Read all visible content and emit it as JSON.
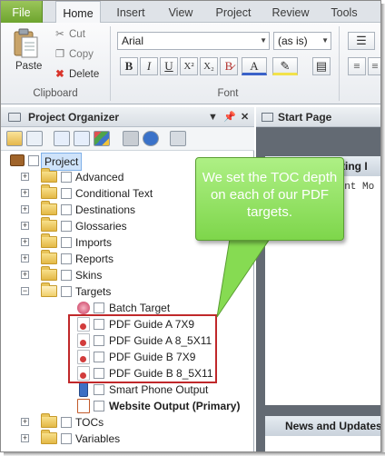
{
  "ribbon": {
    "tabs": [
      "File",
      "Home",
      "Insert",
      "View",
      "Project",
      "Review",
      "Tools"
    ],
    "clipboard": {
      "paste": "Paste",
      "cut": "Cut",
      "copy": "Copy",
      "delete": "Delete",
      "label": "Clipboard"
    },
    "font": {
      "family": "Arial",
      "size": "(as is)",
      "label": "Font"
    },
    "format_buttons": [
      "B",
      "I",
      "U",
      "X²",
      "X₂"
    ]
  },
  "project_organizer": {
    "title": "Project Organizer",
    "root": "Project",
    "folders_top": [
      "Advanced",
      "Conditional Text",
      "Destinations",
      "Glossaries",
      "Imports",
      "Reports",
      "Skins",
      "Targets"
    ],
    "targets": [
      "Batch Target",
      "PDF Guide A 7X9",
      "PDF Guide A 8_5X11",
      "PDF Guide B 7X9",
      "PDF Guide B 8_5X11",
      "Smart Phone Output",
      "Website Output (Primary)"
    ],
    "folders_bottom": [
      "TOCs",
      "Variables"
    ]
  },
  "start_page": {
    "tab": "Start Page",
    "section1": "isting I",
    "section1_text": "rint Mo",
    "section2": "News and Updates"
  },
  "callout": {
    "text": "We set the TOC depth on each of our PDF targets."
  },
  "colors": {
    "callout": "#8fe35e",
    "highlight": "#c0282a",
    "file_tab": "#7cb342"
  }
}
